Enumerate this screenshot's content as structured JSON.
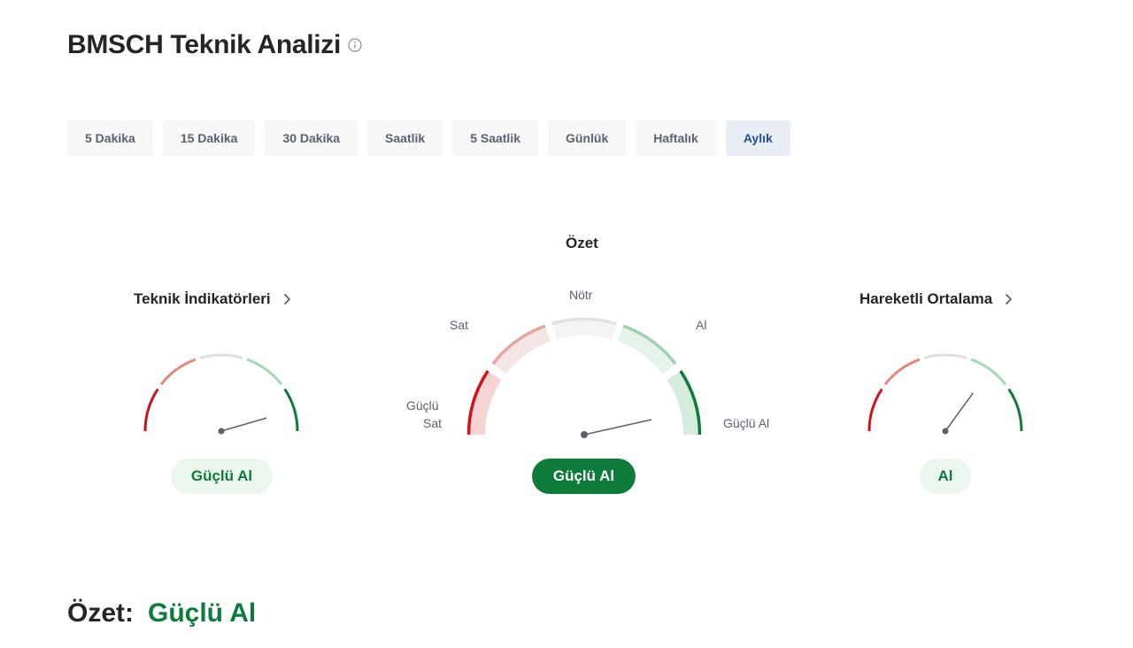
{
  "header": {
    "title": "BMSCH Teknik Analizi",
    "info_icon": "info-icon"
  },
  "tabs": [
    {
      "label": "5 Dakika",
      "active": false
    },
    {
      "label": "15 Dakika",
      "active": false
    },
    {
      "label": "30 Dakika",
      "active": false
    },
    {
      "label": "Saatlik",
      "active": false
    },
    {
      "label": "5 Saatlik",
      "active": false
    },
    {
      "label": "Günlük",
      "active": false
    },
    {
      "label": "Haftalık",
      "active": false
    },
    {
      "label": "Aylık",
      "active": true
    }
  ],
  "gauges": {
    "left": {
      "title": "Teknik İndikatörleri",
      "result": "Güçlü Al",
      "needle_level": 0.91
    },
    "center": {
      "title": "Özet",
      "labels": {
        "strong_sell_1": "Güçlü",
        "strong_sell_2": "Sat",
        "sell": "Sat",
        "neutral": "Nötr",
        "buy": "Al",
        "strong_buy": "Güçlü Al"
      },
      "result": "Güçlü Al",
      "needle_level": 0.93
    },
    "right": {
      "title": "Hareketli Ortalama",
      "result": "Al",
      "needle_level": 0.7
    }
  },
  "summary": {
    "label": "Özet:",
    "value": "Güçlü Al"
  },
  "colors": {
    "strong_sell": "#d0121a",
    "sell": "#e08a80",
    "neutral": "#dedede",
    "buy": "#a6d8b6",
    "strong_buy": "#0d7c3b",
    "active_tab_text": "#1e4f9c"
  }
}
